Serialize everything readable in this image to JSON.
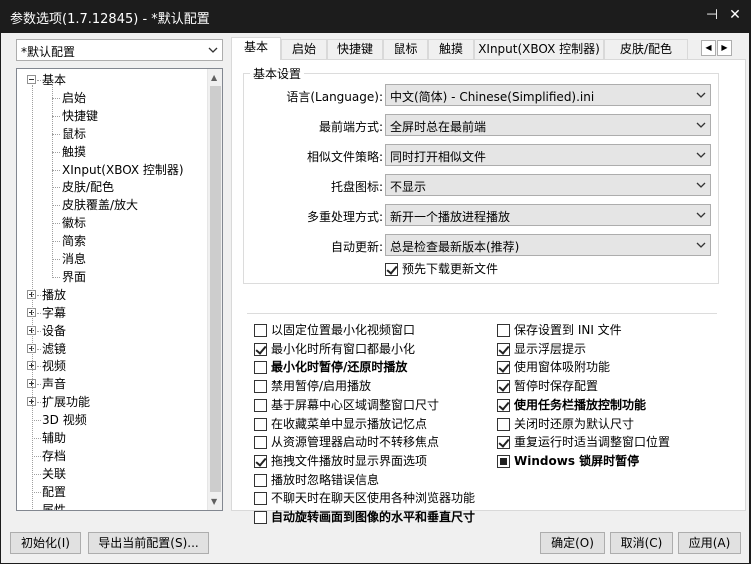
{
  "window": {
    "title": "参数选项(1.7.12845) - *默认配置",
    "pin_glyph": "⊣",
    "close_glyph": "✕"
  },
  "profile": {
    "value": "*默认配置"
  },
  "tree": {
    "items": [
      {
        "label": "基本",
        "expander": "minus"
      },
      {
        "label": "启始"
      },
      {
        "label": "快捷键"
      },
      {
        "label": "鼠标"
      },
      {
        "label": "触摸"
      },
      {
        "label": "XInput(XBOX 控制器)"
      },
      {
        "label": "皮肤/配色"
      },
      {
        "label": "皮肤覆盖/放大"
      },
      {
        "label": "徽标"
      },
      {
        "label": "简索"
      },
      {
        "label": "消息"
      },
      {
        "label": "界面"
      },
      {
        "label": "播放",
        "expander": "plus"
      },
      {
        "label": "字幕",
        "expander": "plus"
      },
      {
        "label": "设备",
        "expander": "plus"
      },
      {
        "label": "滤镜",
        "expander": "plus"
      },
      {
        "label": "视频",
        "expander": "plus"
      },
      {
        "label": "声音",
        "expander": "plus"
      },
      {
        "label": "扩展功能",
        "expander": "plus"
      },
      {
        "label": "3D 视频"
      },
      {
        "label": "辅助"
      },
      {
        "label": "存档"
      },
      {
        "label": "关联"
      },
      {
        "label": "配置"
      },
      {
        "label": "属性"
      }
    ]
  },
  "tabs": {
    "items": [
      "基本",
      "启始",
      "快捷键",
      "鼠标",
      "触摸",
      "XInput(XBOX 控制器)",
      "皮肤/配色"
    ],
    "active": "基本",
    "nav_left": "◀",
    "nav_right": "▶"
  },
  "basic": {
    "group_title": "基本设置",
    "fields": [
      {
        "label": "语言(Language):",
        "value": "中文(简体) - Chinese(Simplified).ini"
      },
      {
        "label": "最前端方式:",
        "value": "全屏时总在最前端"
      },
      {
        "label": "相似文件策略:",
        "value": "同时打开相似文件"
      },
      {
        "label": "托盘图标:",
        "value": "不显示"
      },
      {
        "label": "多重处理方式:",
        "value": "新开一个播放进程播放"
      },
      {
        "label": "自动更新:",
        "value": "总是检查最新版本(推荐)"
      }
    ],
    "predownload": {
      "label": "预先下载更新文件",
      "state": "checked"
    }
  },
  "options_left": [
    {
      "label": "以固定位置最小化视频窗口",
      "state": "unchecked"
    },
    {
      "label": "最小化时所有窗口都最小化",
      "state": "checked"
    },
    {
      "label": "最小化时暂停/还原时播放",
      "state": "unchecked",
      "bold": true
    },
    {
      "label": "禁用暂停/启用播放",
      "state": "unchecked"
    },
    {
      "label": "基于屏幕中心区域调整窗口尺寸",
      "state": "unchecked"
    },
    {
      "label": "在收藏菜单中显示播放记忆点",
      "state": "unchecked"
    },
    {
      "label": "从资源管理器启动时不转移焦点",
      "state": "unchecked"
    },
    {
      "label": "拖拽文件播放时显示界面选项",
      "state": "checked"
    },
    {
      "label": "播放时忽略错误信息",
      "state": "unchecked"
    },
    {
      "label": "不聊天时在聊天区使用各种浏览器功能",
      "state": "unchecked"
    },
    {
      "label": "自动旋转画面到图像的水平和垂直尺寸",
      "state": "unchecked",
      "bold": true
    }
  ],
  "options_right": [
    {
      "label": "保存设置到 INI 文件",
      "state": "unchecked"
    },
    {
      "label": "显示浮层提示",
      "state": "checked"
    },
    {
      "label": "使用窗体吸附功能",
      "state": "checked"
    },
    {
      "label": "暂停时保存配置",
      "state": "checked"
    },
    {
      "label": "使用任务栏播放控制功能",
      "state": "checked",
      "bold": true
    },
    {
      "label": "关闭时还原为默认尺寸",
      "state": "unchecked"
    },
    {
      "label": "重复运行时适当调整窗口位置",
      "state": "checked"
    },
    {
      "label": "Windows 锁屏时暂停",
      "state": "indeterminate",
      "bold": true
    }
  ],
  "buttons": {
    "init": "初始化(I)",
    "export": "导出当前配置(S)...",
    "ok": "确定(O)",
    "cancel": "取消(C)",
    "apply": "应用(A)"
  }
}
